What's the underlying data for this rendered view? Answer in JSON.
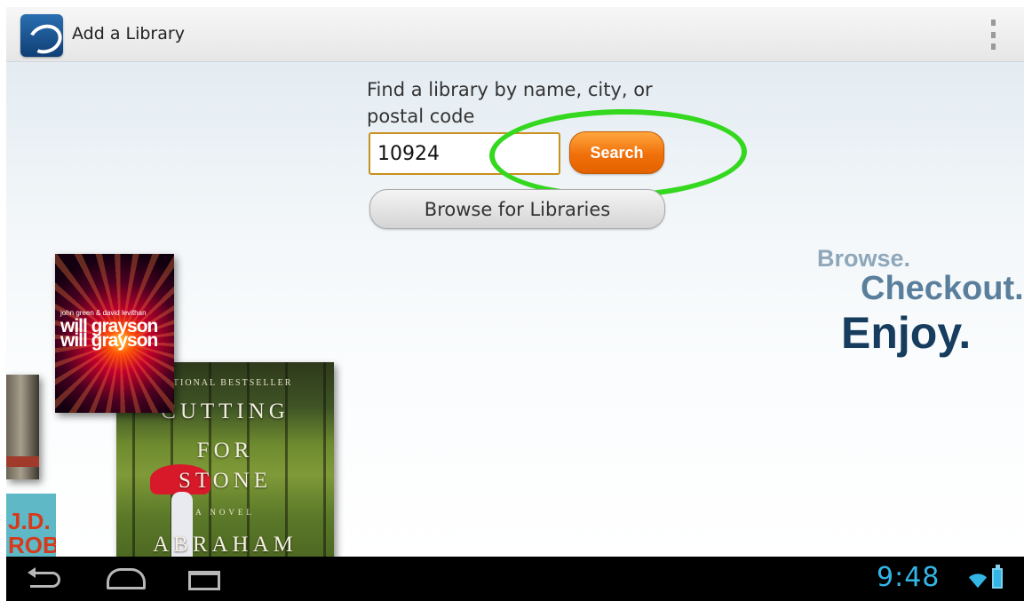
{
  "action_bar": {
    "title": "Add a Library",
    "app_icon": "overdrive-logo-icon",
    "overflow_icon": "overflow-menu-icon"
  },
  "search": {
    "prompt": "Find a library by name, city, or postal code",
    "value": "10924",
    "button_label": "Search",
    "accent_color": "#f37a12",
    "highlight_color": "#34d81f"
  },
  "browse": {
    "button_label": "Browse for Libraries"
  },
  "tagline": {
    "line1": "Browse.",
    "line2": "Checkout.",
    "line3": "Enjoy."
  },
  "books": {
    "cutting": {
      "kicker": "NATIONAL BESTSELLER",
      "title_1": "CUTTING",
      "title_2": "FOR",
      "title_3": "STONE",
      "novel": "A NOVEL",
      "author": "ABRAHAM"
    },
    "will": {
      "authors": "john green & david levithan",
      "title_1": "will grayson",
      "title_2": "will grayson"
    },
    "jd": {
      "author_1": "J.D.",
      "author_2": "ROBB"
    }
  },
  "status_bar": {
    "time": "9:48",
    "wifi_icon": "wifi-icon",
    "battery_icon": "battery-charging-icon",
    "color": "#33b5e5"
  },
  "nav_bar": {
    "back_icon": "back-icon",
    "home_icon": "home-icon",
    "recent_icon": "recent-apps-icon"
  }
}
